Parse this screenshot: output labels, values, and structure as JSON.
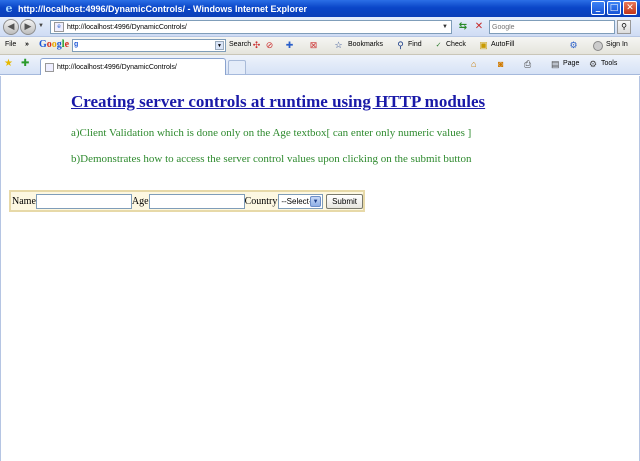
{
  "window": {
    "title": "http://localhost:4996/DynamicControls/ - Windows Internet Explorer",
    "buttons": {
      "minimize": "_",
      "maximize": "□",
      "close": "✕"
    }
  },
  "address_bar": {
    "url": "http://localhost:4996/DynamicControls/",
    "search_placeholder": "Google"
  },
  "toolbar": {
    "file_menu": "File",
    "chevron": "»",
    "google_search_value": "",
    "google_button": "g",
    "search_label": "Search",
    "bookmarks_label": "Bookmarks",
    "find_label": "Find",
    "check_label": "Check",
    "autofill_label": "AutoFill",
    "signin_label": "Sign In"
  },
  "tabs": {
    "active_tab_label": "http://localhost:4996/DynamicControls/",
    "page_label": "Page",
    "tools_label": "Tools"
  },
  "page": {
    "heading": "Creating server controls at runtime using HTTP modules",
    "desc_a": "a)Client Validation which is done only on the Age textbox[ can enter only numeric values ]",
    "desc_b": "b)Demonstrates how to access the server control values upon clicking on the submit button",
    "form": {
      "name_label": "Name",
      "name_value": "",
      "age_label": "Age",
      "age_value": "",
      "country_label": "Country",
      "country_selected": "--Select--",
      "submit_label": "Submit"
    }
  },
  "colors": {
    "title_bar": "#0a46c8",
    "heading": "#1a1aa8",
    "description": "#2e8a2e",
    "form_background": "#fdf8e2"
  }
}
